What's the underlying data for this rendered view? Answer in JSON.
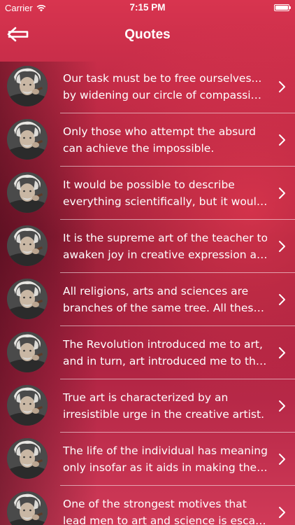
{
  "status_bar": {
    "carrier": "Carrier",
    "time": "7:15 PM",
    "wifi_icon": "wifi-icon",
    "battery_icon": "battery-icon"
  },
  "nav": {
    "title": "Quotes",
    "back_icon": "back-arrow-icon"
  },
  "quotes": [
    {
      "line1": "Our task must be to free ourselves...",
      "line2": "by widening our circle of compassi…"
    },
    {
      "line1": "Only those who attempt the absurd",
      "line2": "can achieve the impossible."
    },
    {
      "line1": "It would be possible to describe",
      "line2": "everything scientifically, but it woul…"
    },
    {
      "line1": "It is the supreme art of the teacher to",
      "line2": "awaken joy in creative expression a…"
    },
    {
      "line1": "All religions, arts and sciences are",
      "line2": "branches of the same tree. All thes…"
    },
    {
      "line1": "The Revolution introduced me to art,",
      "line2": "and in turn, art introduced me to th…"
    },
    {
      "line1": "True art is characterized by an",
      "line2": "irresistible urge in the creative artist."
    },
    {
      "line1": "The life of the individual has meaning",
      "line2": "only insofar as it aids in making the…"
    },
    {
      "line1": "One of the strongest motives that",
      "line2": "lead men to art and science is esca…"
    }
  ],
  "colors": {
    "header_red": "#d8344f",
    "text": "#ffffff"
  }
}
